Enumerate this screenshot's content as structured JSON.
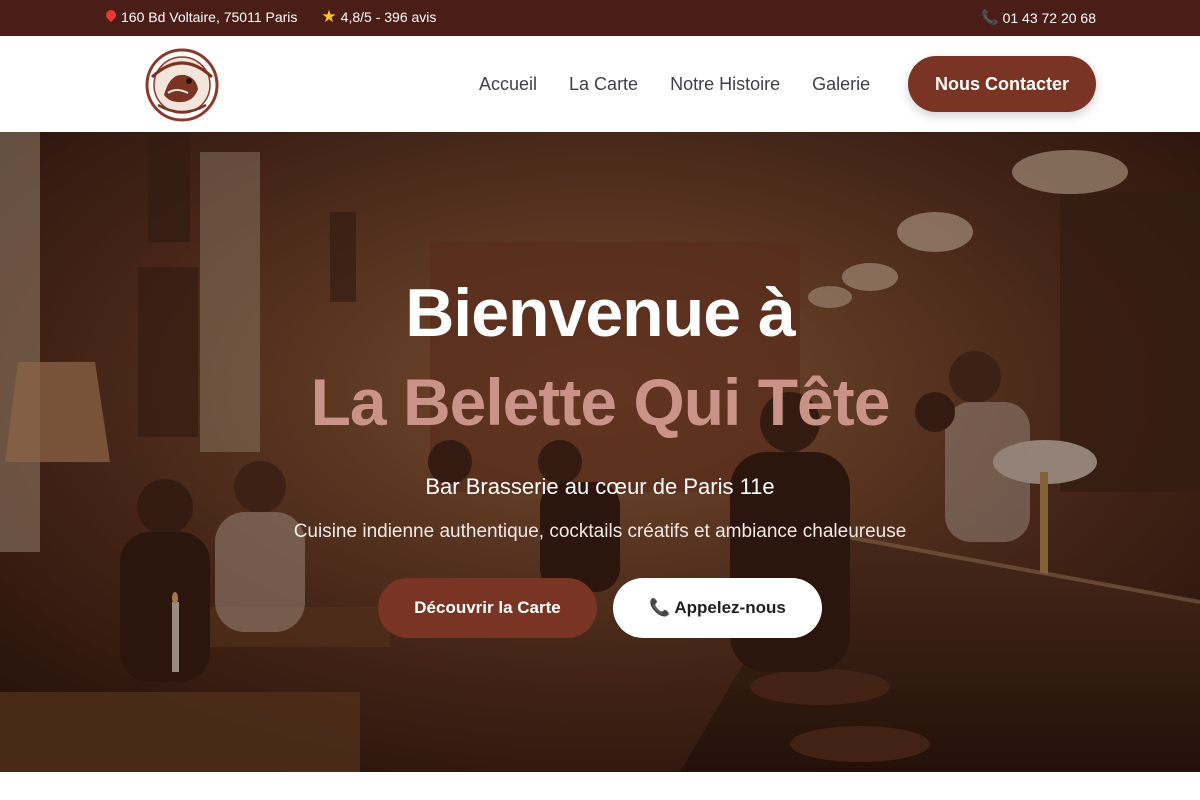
{
  "topbar": {
    "address": "160 Bd Voltaire, 75011 Paris",
    "rating": "4,8/5 - 396 avis",
    "phone": "01 43 72 20 68"
  },
  "header": {
    "logo_alt": "La Belette Qui Tête Restaurant",
    "nav": [
      "Accueil",
      "La Carte",
      "Notre Histoire",
      "Galerie"
    ],
    "cta": "Nous Contacter"
  },
  "hero": {
    "title_line1": "Bienvenue à",
    "title_line2": "La Belette Qui Tête",
    "subtitle": "Bar Brasserie au cœur de Paris 11e",
    "tagline": "Cuisine indienne authentique, cocktails créatifs et ambiance chaleureuse",
    "primary_button": "Découvrir la Carte",
    "secondary_button": "Appelez-nous"
  },
  "colors": {
    "topbar_bg": "#4a1d17",
    "accent": "#7a3424",
    "title_accent": "#c9938a"
  },
  "icons": {
    "address": "map-pin-icon",
    "rating": "star-icon",
    "phone": "phone-icon"
  }
}
